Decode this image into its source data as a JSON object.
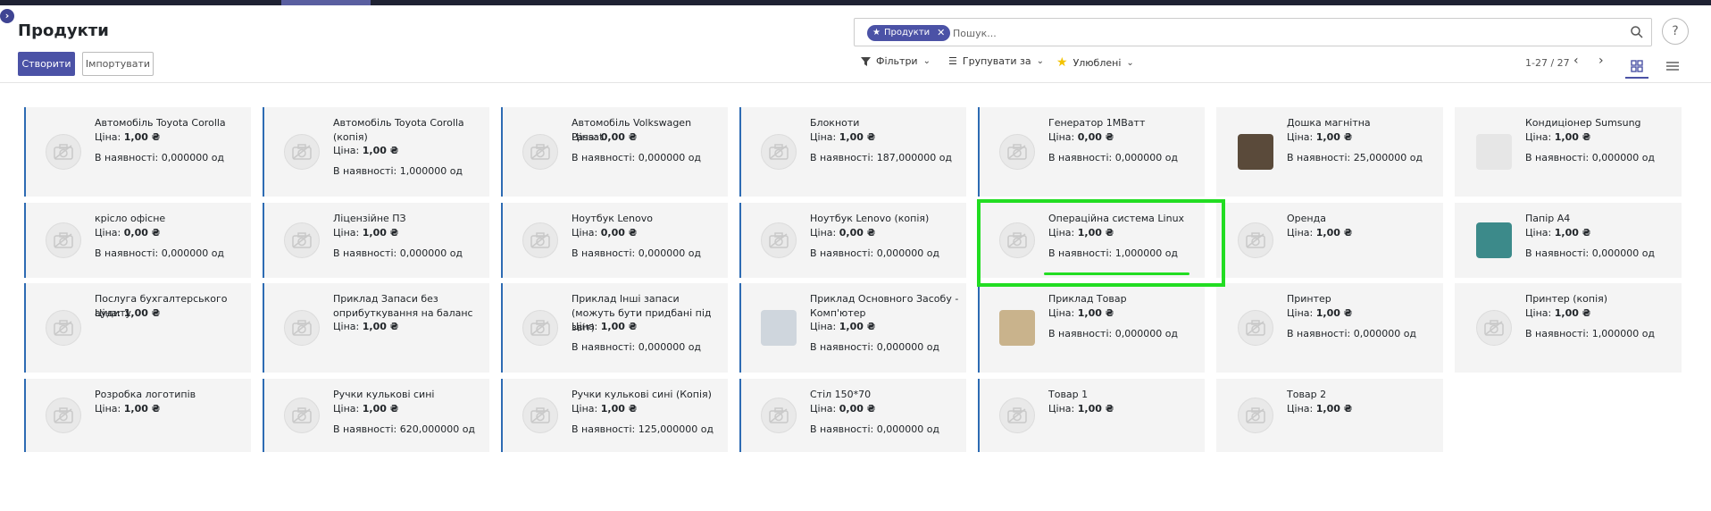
{
  "app": {
    "title": "Продукти"
  },
  "actions": {
    "create_label": "Створити",
    "import_label": "Імпортувати"
  },
  "search": {
    "facet_label": "Продукти",
    "placeholder": "Пошук..."
  },
  "toolbar": {
    "filters_label": "Фільтри",
    "group_by_label": "Групувати за",
    "favorites_label": "Улюблені",
    "pager_text": "1-27 / 27"
  },
  "labels": {
    "price_prefix": "Ціна:",
    "stock_prefix": "В наявності:",
    "help": "?"
  },
  "colors": {
    "accent": "#4b52a6",
    "card_border": "#2d6bb3",
    "highlight": "#22dd22",
    "card_bg": "#f4f4f4"
  },
  "products": [
    {
      "name": "Автомобіль Toyota Corolla",
      "price": "1,00 ₴",
      "stock": "0,000000 од",
      "image": "placeholder-icon"
    },
    {
      "name": "Автомобіль Toyota Corolla (копія)",
      "price": "1,00 ₴",
      "stock": "1,000000 од",
      "image": "placeholder-icon"
    },
    {
      "name": "Автомобіль Volkswagen Passat",
      "price": "0,00 ₴",
      "stock": "0,000000 од",
      "image": "placeholder-icon"
    },
    {
      "name": "Блокноти",
      "price": "1,00 ₴",
      "stock": "187,000000 од",
      "image": "placeholder-icon"
    },
    {
      "name": "Генератор 1МВатт",
      "price": "0,00 ₴",
      "stock": "0,000000 од",
      "image": "placeholder-icon"
    },
    {
      "name": "Дошка магнітна",
      "price": "1,00 ₴",
      "stock": "25,000000 од",
      "image": "magnetic-board-photo"
    },
    {
      "name": "Кондиціонер Sumsung",
      "price": "1,00 ₴",
      "stock": "0,000000 од",
      "image": "air-conditioner-photo"
    },
    {
      "name": "крісло офісне",
      "price": "0,00 ₴",
      "stock": "0,000000 од",
      "image": "placeholder-icon"
    },
    {
      "name": "Ліцензійне ПЗ",
      "price": "1,00 ₴",
      "stock": "0,000000 од",
      "image": "placeholder-icon"
    },
    {
      "name": "Ноутбук Lenovo",
      "price": "0,00 ₴",
      "stock": "0,000000 од",
      "image": "placeholder-icon"
    },
    {
      "name": "Ноутбук Lenovo (копія)",
      "price": "0,00 ₴",
      "stock": "0,000000 од",
      "image": "placeholder-icon"
    },
    {
      "name": "Операційна система Linux",
      "price": "1,00 ₴",
      "stock": "1,000000 од",
      "image": "placeholder-icon"
    },
    {
      "name": "Оренда",
      "price": "1,00 ₴",
      "stock": "",
      "image": "placeholder-icon"
    },
    {
      "name": "Папір А4",
      "price": "1,00 ₴",
      "stock": "0,000000 од",
      "image": "paper-photo"
    },
    {
      "name": "Послуга бухгалтерського аудиту",
      "price": "1,00 ₴",
      "stock": "",
      "image": "placeholder-icon"
    },
    {
      "name": "Приклад Запаси без оприбуткування на баланс",
      "price": "1,00 ₴",
      "stock": "",
      "image": "placeholder-icon"
    },
    {
      "name": "Приклад Інші запаси (можуть бути придбані під звіт)",
      "price": "1,00 ₴",
      "stock": "0,000000 од",
      "image": "placeholder-icon"
    },
    {
      "name": "Приклад Основного Засобу - Комп'ютер",
      "price": "1,00 ₴",
      "stock": "0,000000 од",
      "image": "computer-photo"
    },
    {
      "name": "Приклад Товар",
      "price": "1,00 ₴",
      "stock": "0,000000 од",
      "image": "product-photo"
    },
    {
      "name": "Принтер",
      "price": "1,00 ₴",
      "stock": "0,000000 од",
      "image": "placeholder-icon"
    },
    {
      "name": "Принтер (копія)",
      "price": "1,00 ₴",
      "stock": "1,000000 од",
      "image": "placeholder-icon"
    },
    {
      "name": "Розробка логотипів",
      "price": "1,00 ₴",
      "stock": "",
      "image": "placeholder-icon"
    },
    {
      "name": "Ручки кулькові сині",
      "price": "1,00 ₴",
      "stock": "620,000000 од",
      "image": "placeholder-icon"
    },
    {
      "name": "Ручки кулькові сині (Копія)",
      "price": "1,00 ₴",
      "stock": "125,000000 од",
      "image": "placeholder-icon"
    },
    {
      "name": "Стіл 150*70",
      "price": "0,00 ₴",
      "stock": "0,000000 од",
      "image": "placeholder-icon"
    },
    {
      "name": "Товар 1",
      "price": "1,00 ₴",
      "stock": "",
      "image": "placeholder-icon"
    },
    {
      "name": "Товар 2",
      "price": "1,00 ₴",
      "stock": "",
      "image": "placeholder-icon"
    }
  ]
}
